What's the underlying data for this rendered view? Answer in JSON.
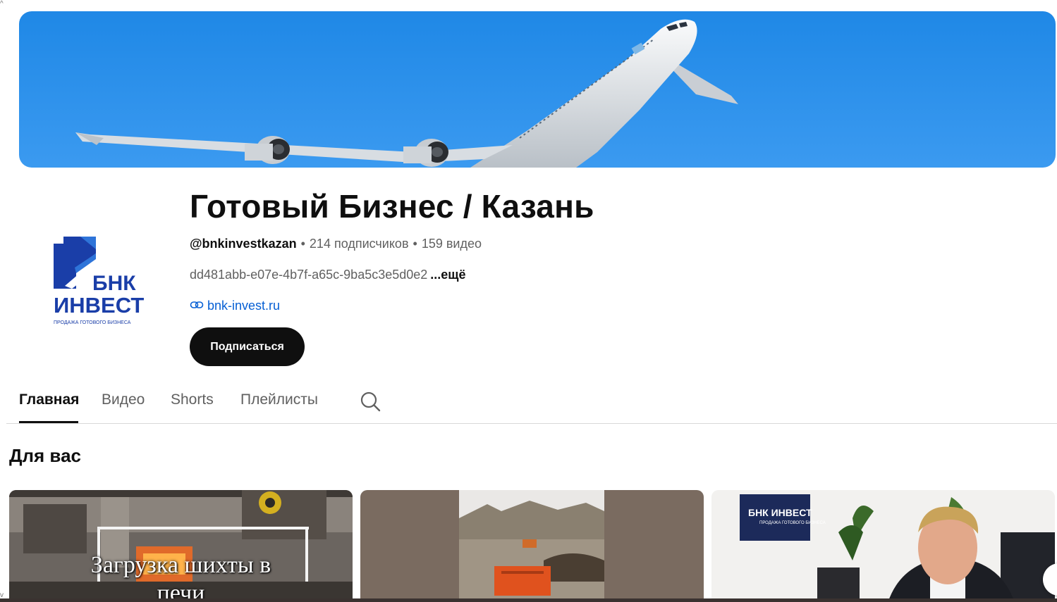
{
  "channel": {
    "title": "Готовый Бизнес / Казань",
    "handle": "@bnkinvestkazan",
    "subscribers": "214 подписчиков",
    "videos": "159 видео",
    "description": "dd481abb-e07e-4b7f-a65c-9ba5c3e5d0e2",
    "more_label": "...ещё",
    "link": "bnk-invest.ru",
    "subscribe_label": "Подписаться"
  },
  "logo": {
    "line1": "БНК",
    "line2": "ИНВЕСТ",
    "tagline": "ПРОДАЖА ГОТОВОГО БИЗНЕСА"
  },
  "tabs": [
    {
      "label": "Главная",
      "active": true
    },
    {
      "label": "Видео",
      "active": false
    },
    {
      "label": "Shorts",
      "active": false
    },
    {
      "label": "Плейлисты",
      "active": false
    }
  ],
  "section": {
    "title": "Для вас"
  },
  "videos": [
    {
      "overlay_line1": "Загрузка шихты в",
      "overlay_line2": "печи"
    },
    {
      "overlay_line1": "",
      "overlay_line2": ""
    },
    {
      "poster_text": "БНК ИНВЕСТ",
      "poster_sub": "ПРОДАЖА ГОТОВОГО БИЗНЕСА"
    }
  ],
  "colors": {
    "sky": "#2b8fe8",
    "brand_blue": "#1a3ea8",
    "link": "#065fd4",
    "button": "#0f0f0f"
  },
  "icons": [
    "link-icon",
    "search-icon"
  ]
}
